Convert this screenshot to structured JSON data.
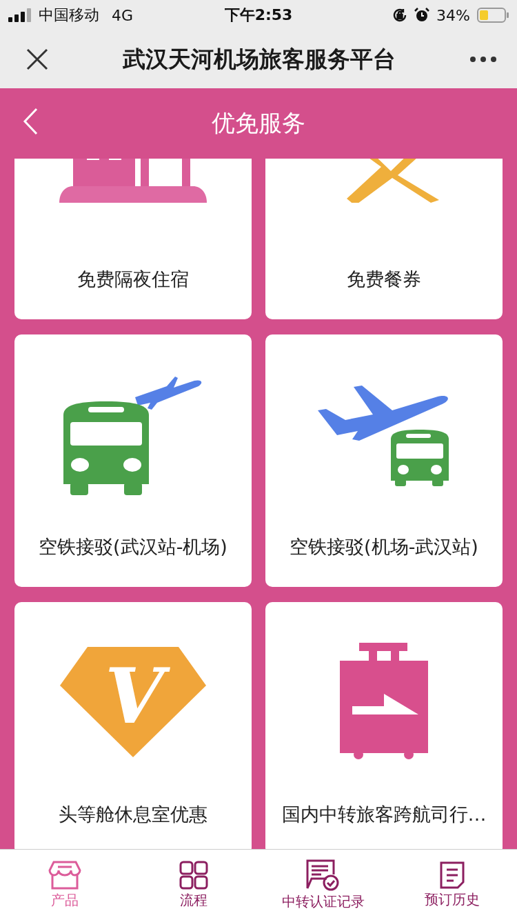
{
  "status_bar": {
    "carrier": "中国移动",
    "network": "4G",
    "time": "下午2:53",
    "battery": "34%"
  },
  "window": {
    "title": "武汉天河机场旅客服务平台"
  },
  "header": {
    "title": "优免服务"
  },
  "services": [
    {
      "label": "免费隔夜住宿",
      "kind": "hotel"
    },
    {
      "label": "免费餐券",
      "kind": "meal"
    },
    {
      "label": "空铁接驳(武汉站-机场)",
      "kind": "bus-plane"
    },
    {
      "label": "空铁接驳(机场-武汉站)",
      "kind": "plane-bus"
    },
    {
      "label": "头等舱休息室优惠",
      "kind": "lounge",
      "badge": "V"
    },
    {
      "label": "国内中转旅客跨航司行…",
      "kind": "luggage"
    }
  ],
  "tabs": [
    {
      "label": "产品",
      "kind": "store",
      "selected": true
    },
    {
      "label": "流程",
      "kind": "grid",
      "selected": false
    },
    {
      "label": "中转认证记录",
      "kind": "certify",
      "selected": false
    },
    {
      "label": "预订历史",
      "kind": "history",
      "selected": false
    }
  ]
}
